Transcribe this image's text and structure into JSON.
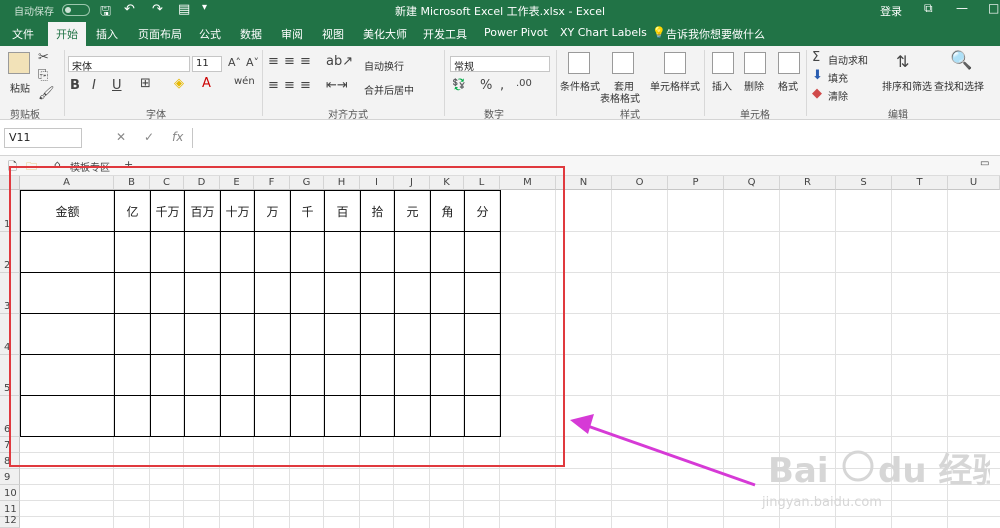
{
  "titlebar": {
    "autosave_label": "自动保存",
    "title": "新建 Microsoft Excel 工作表.xlsx  -  Excel",
    "login_label": "登录"
  },
  "tabs": [
    "文件",
    "开始",
    "插入",
    "页面布局",
    "公式",
    "数据",
    "审阅",
    "视图",
    "美化大师",
    "开发工具",
    "Power Pivot",
    "XY Chart Labels",
    "告诉我你想要做什么"
  ],
  "active_tab": "开始",
  "ribbon": {
    "clipboard": {
      "paste_label": "粘贴",
      "group_label": "剪贴板"
    },
    "font": {
      "font_name": "宋体",
      "font_size": "11",
      "group_label": "字体",
      "bold": "B",
      "italic": "I",
      "underline": "U"
    },
    "alignment": {
      "wrap_label": "自动换行",
      "merge_label": "合并后居中",
      "group_label": "对齐方式"
    },
    "number": {
      "format": "常规",
      "group_label": "数字"
    },
    "styles": {
      "conditional_label": "条件格式",
      "table_label_1": "套用",
      "table_label_2": "表格格式",
      "cell_styles_label": "单元格样式",
      "group_label": "样式"
    },
    "cells": {
      "insert_label": "插入",
      "delete_label": "删除",
      "format_label": "格式",
      "group_label": "单元格"
    },
    "editing": {
      "autosum_label": "自动求和",
      "fill_label": "填充",
      "clear_label": "清除",
      "sort_label": "排序和筛选",
      "find_label": "查找和选择",
      "group_label": "编辑"
    }
  },
  "formula_bar": {
    "name_box": "V11",
    "fx_label": "fx",
    "value": ""
  },
  "template_bar": {
    "label": "模板专区"
  },
  "columns": [
    "A",
    "B",
    "C",
    "D",
    "E",
    "F",
    "G",
    "H",
    "I",
    "J",
    "K",
    "L",
    "M",
    "N",
    "O",
    "P",
    "Q",
    "R",
    "S",
    "T",
    "U"
  ],
  "rows": [
    "1",
    "2",
    "3",
    "4",
    "5",
    "6",
    "7",
    "8",
    "9",
    "10",
    "11",
    "12"
  ],
  "table": {
    "headers": [
      "金额",
      "亿",
      "千万",
      "百万",
      "十万",
      "万",
      "千",
      "百",
      "拾",
      "元",
      "角",
      "分"
    ],
    "empty_rows": 5
  },
  "colors": {
    "excel_green": "#217346",
    "highlight_box": "#e0393e",
    "arrow": "#d63ad6"
  }
}
